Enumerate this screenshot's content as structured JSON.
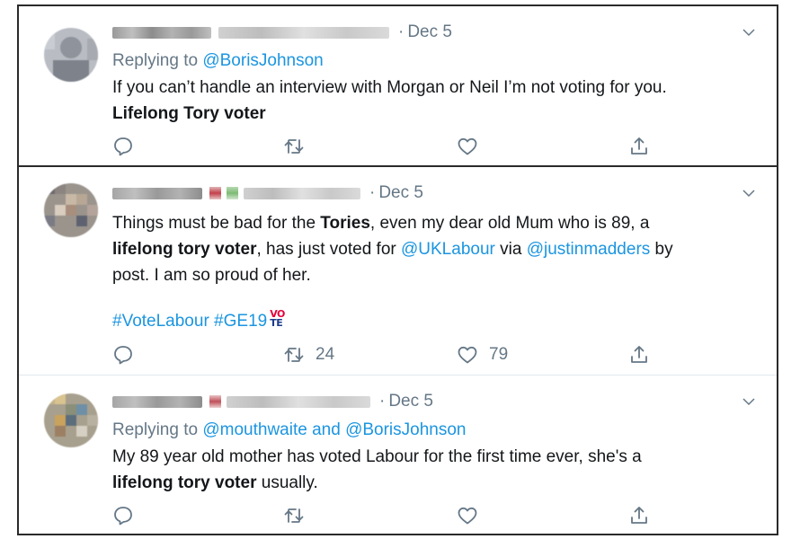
{
  "tweets": [
    {
      "date": "Dec 5",
      "replying_label": "Replying to",
      "replying_to": "@BorisJohnson",
      "line1": "If you can’t handle an interview with Morgan or Neil I’m not voting for you.",
      "line2_bold": "Lifelong Tory voter",
      "retweets": "",
      "likes": ""
    },
    {
      "date": "Dec 5",
      "text_1": "Things must be bad for the ",
      "bold_tories": "Tories",
      "text_2": ", even my dear old Mum who is 89, a",
      "bold_voter": "lifelong tory voter",
      "text_3": ", has just voted for ",
      "mention_1": "@UKLabour",
      "text_4": " via ",
      "mention_2": "@justinmadders",
      "text_5": " by",
      "text_6": "post.  I am so proud of her.",
      "hashtag_1": "#VoteLabour",
      "hashtag_2": "#GE19",
      "badge_top": "VO",
      "badge_bottom": "TE",
      "retweets": "24",
      "likes": "79"
    },
    {
      "date": "Dec 5",
      "replying_label": "Replying to",
      "replying_to_1": "@mouthwaite",
      "replying_and": "and",
      "replying_to_2": "@BorisJohnson",
      "line1": "My 89 year old mother has voted Labour for the first time ever, she's a",
      "line2_bold": "lifelong tory voter",
      "line2_rest": " usually.",
      "retweets": "",
      "likes": ""
    }
  ],
  "icons": {
    "reply": "reply-icon",
    "retweet": "retweet-icon",
    "like": "heart-icon",
    "share": "share-icon",
    "more": "chevron-down-icon"
  },
  "colors": {
    "link": "#1b95e0",
    "muted": "#657786",
    "text": "#14171a"
  }
}
